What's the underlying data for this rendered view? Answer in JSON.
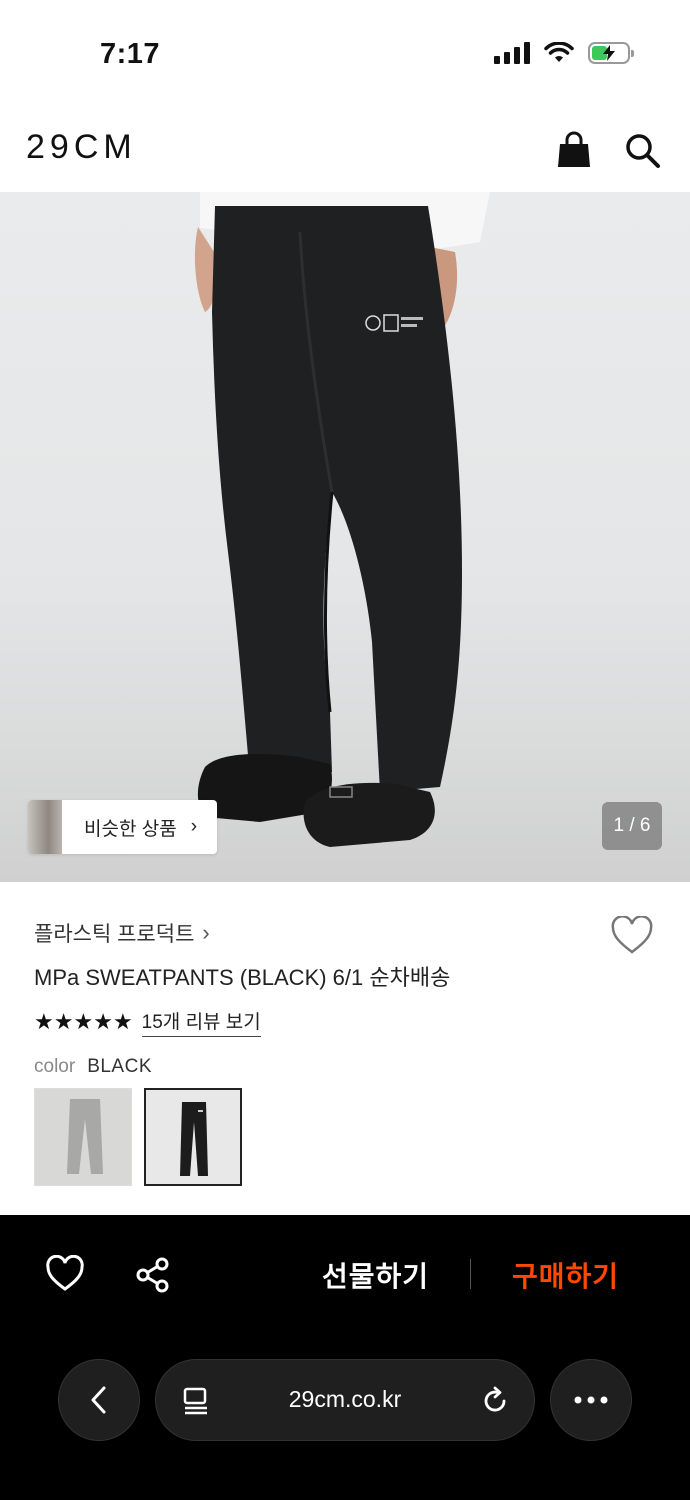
{
  "status_bar": {
    "time": "7:17"
  },
  "header": {
    "logo": "29CM"
  },
  "product_image": {
    "page_counter": "1 / 6",
    "similar_button_label": "비슷한 상품"
  },
  "product": {
    "brand": "플라스틱 프로덕트",
    "name": "MPa SWEATPANTS (BLACK) 6/1 순차배송",
    "rating_stars": 5,
    "review_link": "15개 리뷰 보기",
    "color_label": "color",
    "color_value": "BLACK",
    "swatches": [
      {
        "name": "grey",
        "selected": false
      },
      {
        "name": "black",
        "selected": true
      }
    ]
  },
  "action_bar": {
    "gift_label": "선물하기",
    "buy_label": "구매하기",
    "buy_color": "#ff4800"
  },
  "browser": {
    "url": "29cm.co.kr"
  }
}
